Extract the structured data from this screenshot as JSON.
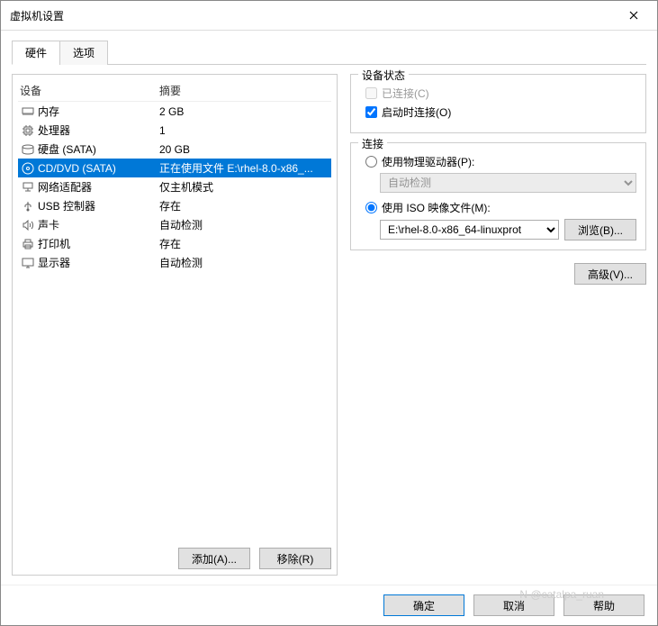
{
  "window": {
    "title": "虚拟机设置"
  },
  "tabs": {
    "hardware": "硬件",
    "options": "选项"
  },
  "list": {
    "header_device": "设备",
    "header_summary": "摘要",
    "items": [
      {
        "icon": "memory-icon",
        "name": "内存",
        "summary": "2 GB"
      },
      {
        "icon": "cpu-icon",
        "name": "处理器",
        "summary": "1"
      },
      {
        "icon": "disk-icon",
        "name": "硬盘 (SATA)",
        "summary": "20 GB"
      },
      {
        "icon": "cd-icon",
        "name": "CD/DVD (SATA)",
        "summary": "正在使用文件 E:\\rhel-8.0-x86_..."
      },
      {
        "icon": "network-icon",
        "name": "网络适配器",
        "summary": "仅主机模式"
      },
      {
        "icon": "usb-icon",
        "name": "USB 控制器",
        "summary": "存在"
      },
      {
        "icon": "sound-icon",
        "name": "声卡",
        "summary": "自动检测"
      },
      {
        "icon": "printer-icon",
        "name": "打印机",
        "summary": "存在"
      },
      {
        "icon": "display-icon",
        "name": "显示器",
        "summary": "自动检测"
      }
    ],
    "selected_index": 3
  },
  "buttons": {
    "add": "添加(A)...",
    "remove": "移除(R)",
    "browse": "浏览(B)...",
    "advanced": "高级(V)...",
    "ok": "确定",
    "cancel": "取消",
    "help": "帮助"
  },
  "status": {
    "legend": "设备状态",
    "connected": "已连接(C)",
    "connect_on_start": "启动时连接(O)"
  },
  "connection": {
    "legend": "连接",
    "use_physical": "使用物理驱动器(P):",
    "physical_value": "自动检测",
    "use_iso": "使用 ISO 映像文件(M):",
    "iso_path": "E:\\rhel-8.0-x86_64-linuxprot"
  },
  "watermark": "N @catalpa_ruan"
}
